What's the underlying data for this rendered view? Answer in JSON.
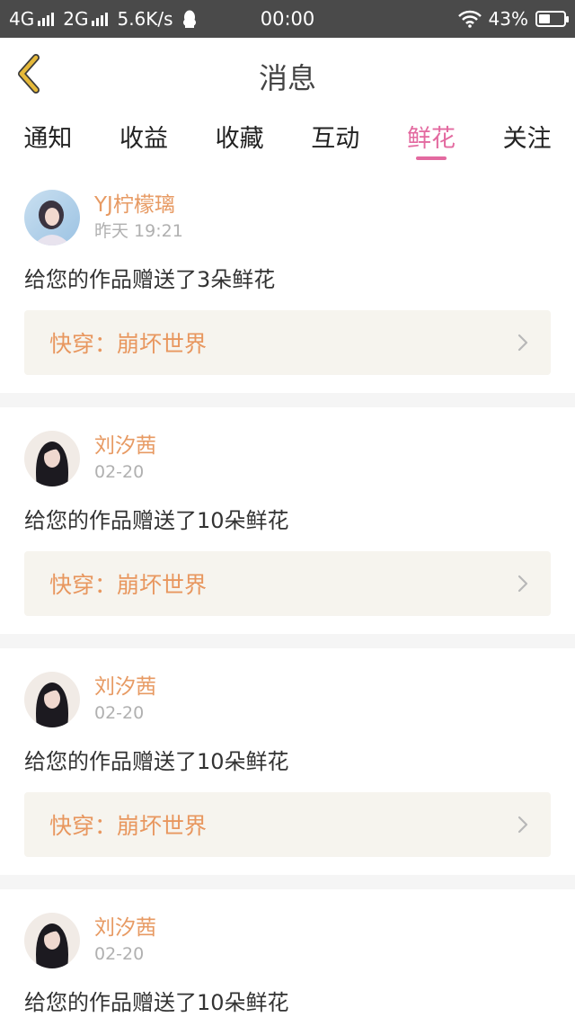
{
  "status_bar": {
    "net1": "4G",
    "net2": "2G",
    "speed": "5.6K/s",
    "time": "00:00",
    "battery": "43%"
  },
  "header": {
    "title": "消息"
  },
  "tabs": [
    {
      "label": "通知"
    },
    {
      "label": "收益"
    },
    {
      "label": "收藏"
    },
    {
      "label": "互动"
    },
    {
      "label": "鲜花",
      "active": true
    },
    {
      "label": "关注"
    }
  ],
  "items": [
    {
      "username": "YJ柠檬璃",
      "time": "昨天 19:21",
      "message": "给您的作品赠送了3朵鲜花",
      "work": "快穿：崩坏世界"
    },
    {
      "username": "刘汐茜",
      "time": "02-20",
      "message": "给您的作品赠送了10朵鲜花",
      "work": "快穿：崩坏世界"
    },
    {
      "username": "刘汐茜",
      "time": "02-20",
      "message": "给您的作品赠送了10朵鲜花",
      "work": "快穿：崩坏世界"
    },
    {
      "username": "刘汐茜",
      "time": "02-20",
      "message": "给您的作品赠送了10朵鲜花",
      "work": "快穿：崩坏世界"
    }
  ],
  "colors": {
    "accent": "#e36aa0",
    "username": "#e79a63",
    "work_bg": "#f6f4ee",
    "back_icon": "#e5b93a"
  },
  "icons": {
    "back": "chevron-left-icon",
    "work_arrow": "chevron-right-icon",
    "qq": "qq-penguin-icon",
    "wifi": "wifi-icon",
    "battery": "battery-icon"
  }
}
